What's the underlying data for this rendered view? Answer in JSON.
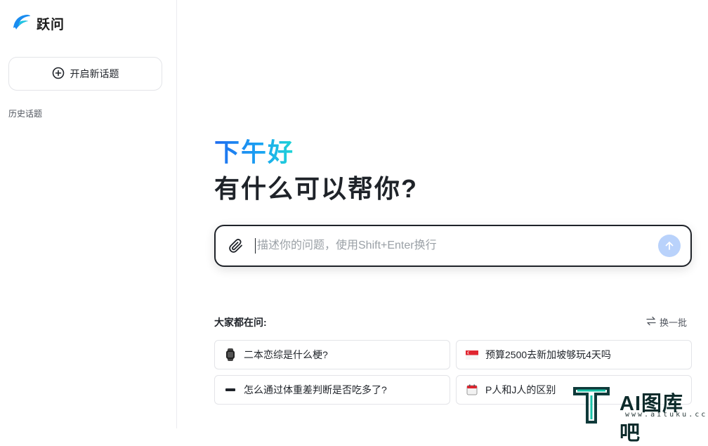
{
  "app": {
    "name": "跃问"
  },
  "sidebar": {
    "new_topic_label": "开启新话题",
    "history_label": "历史话题"
  },
  "hero": {
    "greeting": "下午好",
    "subtitle": "有什么可以帮你?"
  },
  "input": {
    "placeholder": "描述你的问题，使用Shift+Enter换行",
    "value": ""
  },
  "suggestions": {
    "title": "大家都在问:",
    "refresh_label": "换一批",
    "items": [
      {
        "emoji": "⌚",
        "label": "二本恋综是什么梗?"
      },
      {
        "emoji": "🇸🇬",
        "label": "预算2500去新加坡够玩4天吗"
      },
      {
        "emoji": "➖",
        "label": "怎么通过体重差判断是否吃多了?"
      },
      {
        "emoji": "🗓",
        "label": "P人和J人的区别"
      }
    ]
  },
  "watermark": {
    "text": "AI图库吧",
    "sub": "www.aituku.cc"
  },
  "colors": {
    "accent": "#1f6cf0",
    "send_disabled": "#b9d2fb"
  }
}
